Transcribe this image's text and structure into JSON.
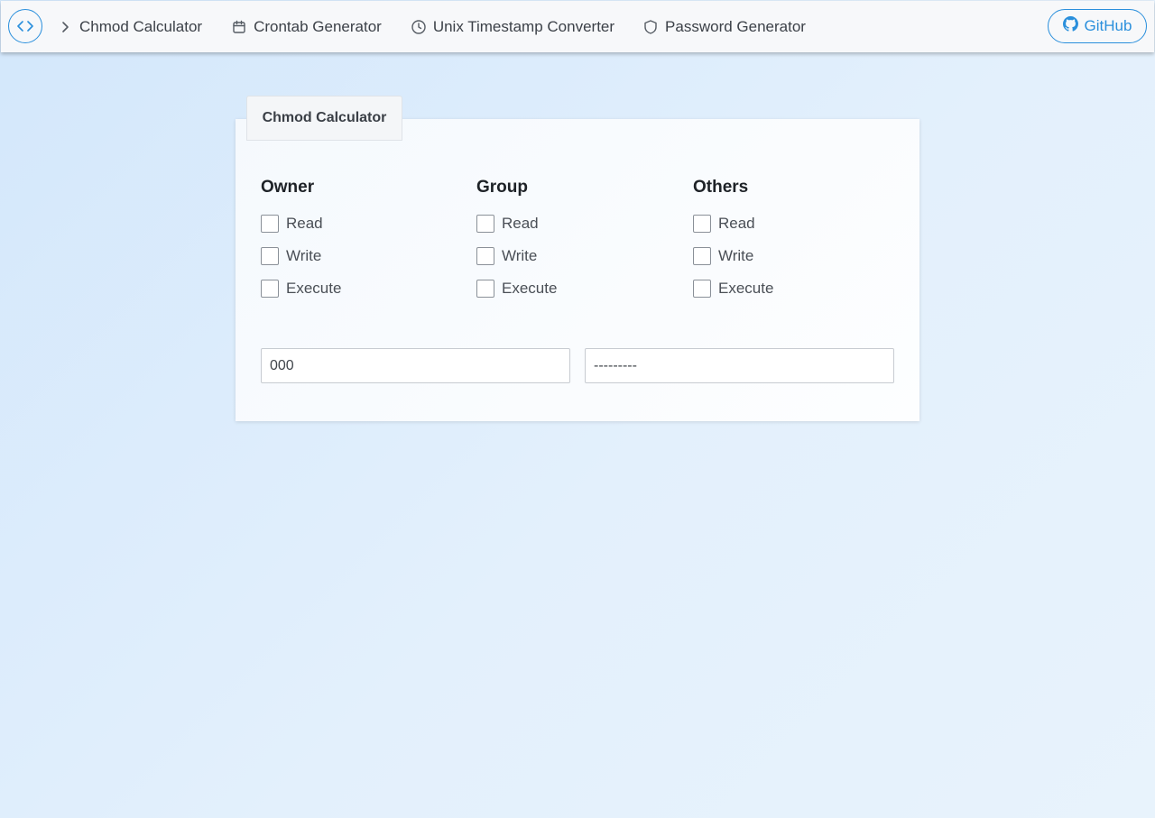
{
  "nav": {
    "logo_icon": "code-brackets-icon",
    "items": [
      {
        "label": "Chmod Calculator",
        "icon": "chevron-right-icon"
      },
      {
        "label": "Crontab Generator",
        "icon": "calendar-icon"
      },
      {
        "label": "Unix Timestamp Converter",
        "icon": "clock-icon"
      },
      {
        "label": "Password Generator",
        "icon": "shield-icon"
      }
    ],
    "github_label": "GitHub"
  },
  "card": {
    "tab_label": "Chmod Calculator",
    "groups": [
      {
        "title": "Owner",
        "perms": [
          "Read",
          "Write",
          "Execute"
        ]
      },
      {
        "title": "Group",
        "perms": [
          "Read",
          "Write",
          "Execute"
        ]
      },
      {
        "title": "Others",
        "perms": [
          "Read",
          "Write",
          "Execute"
        ]
      }
    ],
    "octal_value": "000",
    "symbolic_value": "---------"
  },
  "colors": {
    "accent": "#2a8fdc",
    "background": "#dcecfb"
  }
}
